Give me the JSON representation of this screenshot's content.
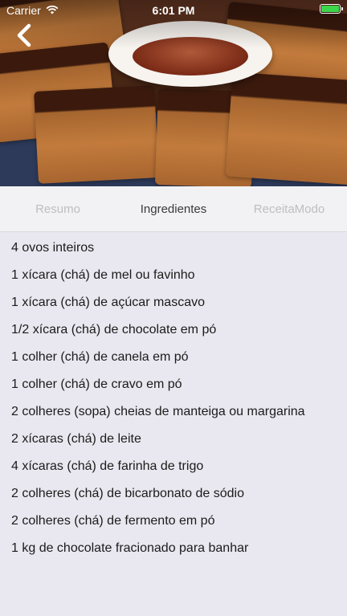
{
  "status_bar": {
    "carrier": "Carrier",
    "time": "6:01 PM",
    "battery_color": "#3cd64a"
  },
  "nav": {
    "back_icon": "chevron-left-icon"
  },
  "tabs": [
    {
      "label": "Resumo",
      "active": false
    },
    {
      "label": "Ingredientes",
      "active": true
    },
    {
      "label": "ReceitaModo",
      "active": false
    }
  ],
  "ingredients": [
    "4 ovos inteiros",
    "1 xícara (chá) de mel ou favinho",
    "1 xícara (chá) de açúcar mascavo",
    "1/2 xícara (chá) de chocolate em pó",
    "1 colher (chá) de canela em pó",
    "1 colher (chá) de cravo em pó",
    "2 colheres (sopa) cheias de manteiga ou margarina",
    "2 xícaras (chá) de leite",
    "4 xícaras (chá) de farinha de trigo",
    "2 colheres (chá) de bicarbonato de sódio",
    "2 colheres (chá) de fermento em pó",
    "1 kg de chocolate fracionado para banhar"
  ]
}
